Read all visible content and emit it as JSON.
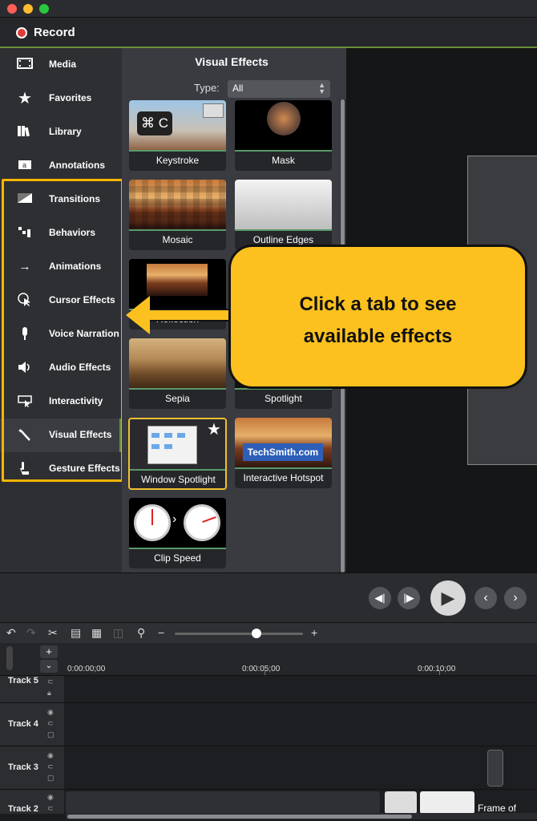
{
  "app": {
    "record_label": "Record"
  },
  "sidebar": {
    "items": [
      {
        "label": "Media",
        "icon": "film-icon"
      },
      {
        "label": "Favorites",
        "icon": "star-icon"
      },
      {
        "label": "Library",
        "icon": "books-icon"
      },
      {
        "label": "Annotations",
        "icon": "callout-icon"
      },
      {
        "label": "Transitions",
        "icon": "transition-icon"
      },
      {
        "label": "Behaviors",
        "icon": "behaviors-icon"
      },
      {
        "label": "Animations",
        "icon": "animation-arrow-icon"
      },
      {
        "label": "Cursor Effects",
        "icon": "cursor-icon"
      },
      {
        "label": "Voice Narration",
        "icon": "microphone-icon"
      },
      {
        "label": "Audio Effects",
        "icon": "speaker-icon"
      },
      {
        "label": "Interactivity",
        "icon": "interactivity-icon"
      },
      {
        "label": "Visual Effects",
        "icon": "magic-wand-icon"
      },
      {
        "label": "Gesture Effects",
        "icon": "hand-gesture-icon"
      }
    ],
    "active": "Visual Effects"
  },
  "panel": {
    "title": "Visual Effects",
    "type_label": "Type:",
    "type_value": "All",
    "tiles": [
      {
        "name": "Keystroke",
        "badge": "⌘ C"
      },
      {
        "name": "Mask"
      },
      {
        "name": "Mosaic"
      },
      {
        "name": "Outline Edges"
      },
      {
        "name": "Reflection"
      },
      {
        "name": ""
      },
      {
        "name": "Sepia"
      },
      {
        "name": "Spotlight"
      },
      {
        "name": "Window Spotlight"
      },
      {
        "name": "Interactive Hotspot",
        "overlay": "TechSmith.com"
      },
      {
        "name": "Clip Speed"
      }
    ]
  },
  "callout": {
    "line1": "Click a tab to see",
    "line2": "available effects"
  },
  "timeline": {
    "times": [
      "0:00:00;00",
      "0:00:05;00",
      "0:00:10;00"
    ],
    "tracks": [
      "Track 5",
      "Track 4",
      "Track 3",
      "Track 2"
    ],
    "clip_label": "Frame of"
  },
  "colors": {
    "accent": "#6a8f3a",
    "highlight": "#f5b400",
    "callout": "#fcc11e",
    "record": "#e23b3b"
  }
}
